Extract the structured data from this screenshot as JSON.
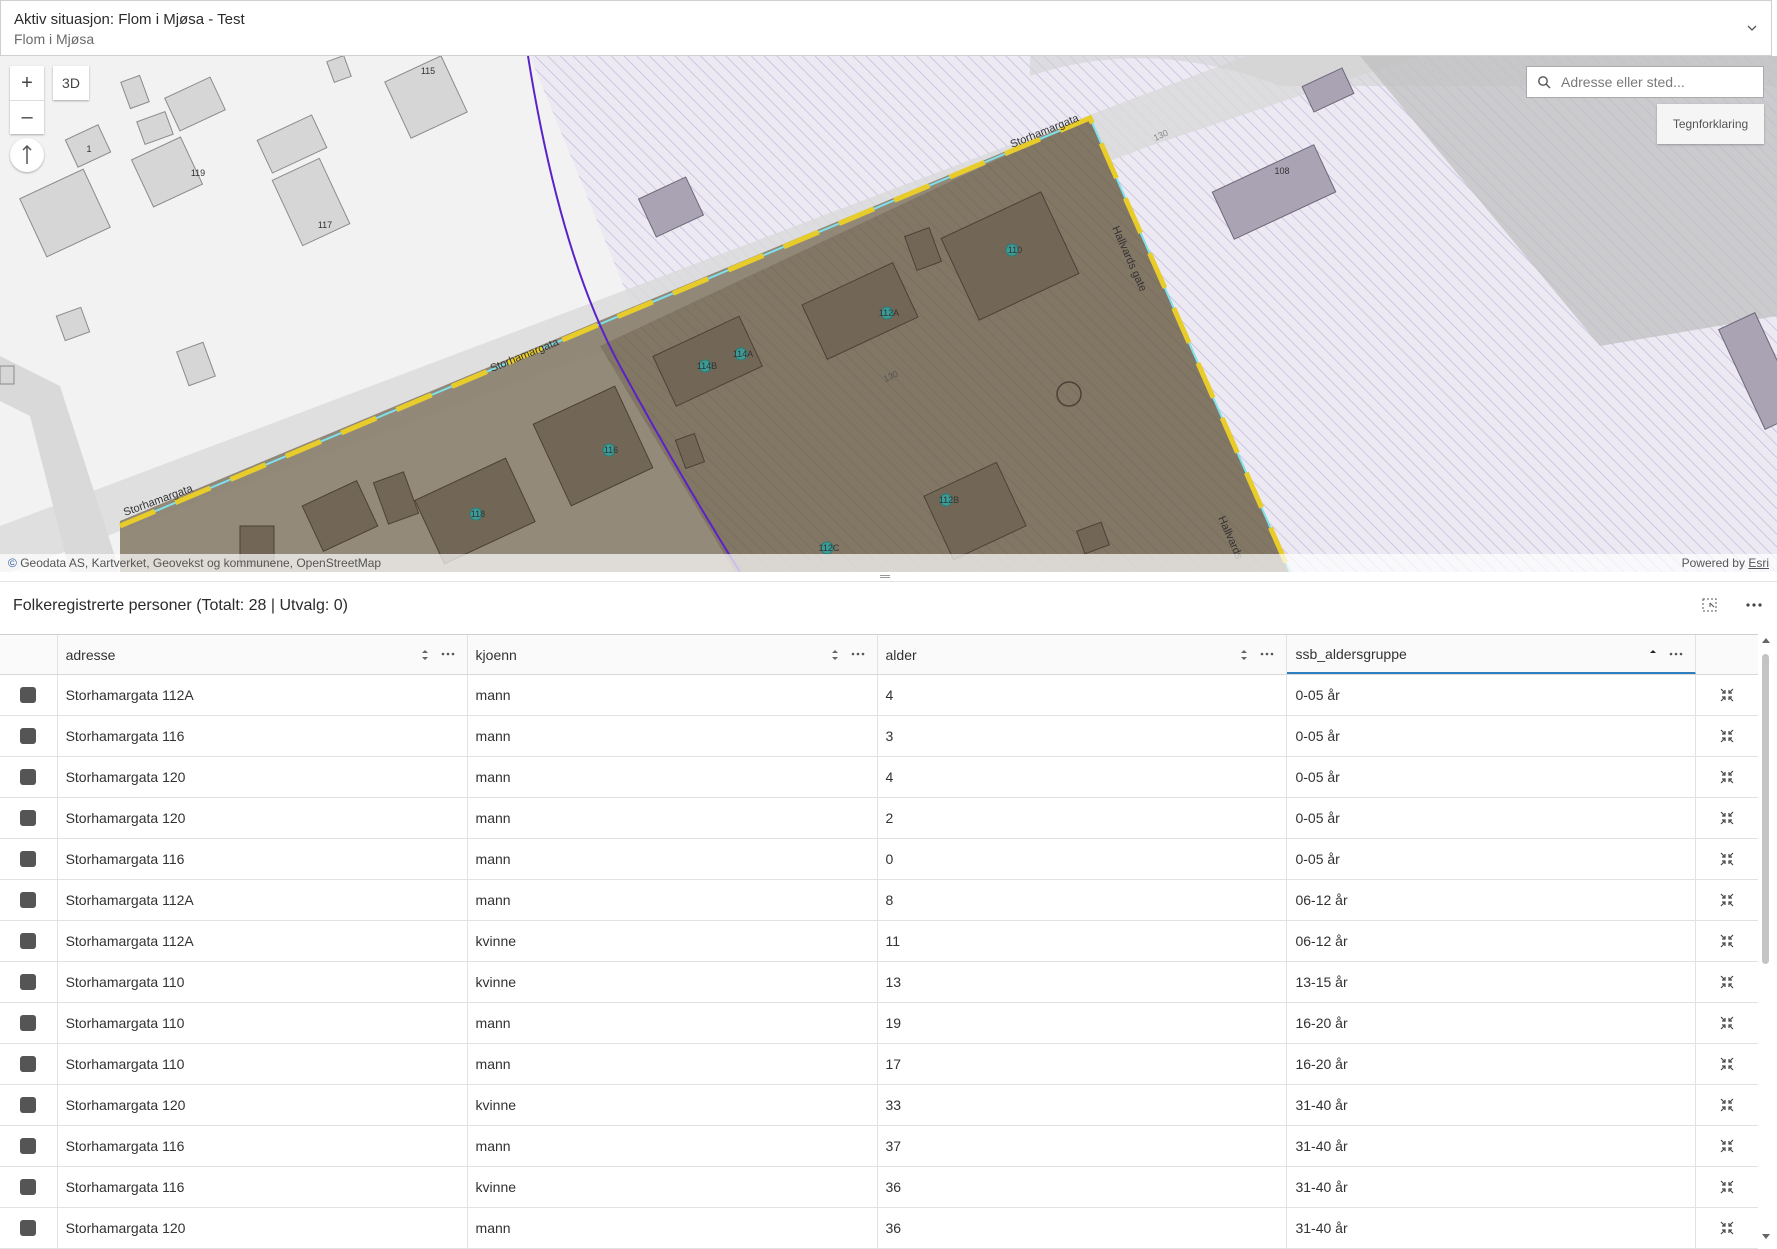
{
  "header": {
    "title": "Aktiv situasjon: Flom i Mjøsa - Test",
    "subtitle": "Flom i Mjøsa"
  },
  "map": {
    "zoom_in": "+",
    "zoom_out": "–",
    "view3d": "3D",
    "search_placeholder": "Adresse eller sted...",
    "legend_button": "Tegnforklaring",
    "attribution": "Geodata AS, Kartverket, Geovekst og kommunene, OpenStreetMap",
    "powered_by": "Powered by",
    "esri": "Esri",
    "labels": {
      "street1": "Storhamargata",
      "street2": "Storhamargata",
      "street3": "Storhamargata",
      "street4": "Hallvards gate",
      "street5": "Hallvards",
      "b115": "115",
      "b1": "1",
      "b119": "119",
      "b117": "117",
      "b108": "108",
      "b110": "110",
      "b112a": "112A",
      "b114a": "114A",
      "b114b": "114B",
      "b116": "116",
      "b118": "118",
      "b112b": "112B",
      "b112c": "112C",
      "c130a": "130",
      "c130b": "130"
    },
    "colors": {
      "flood_area": "#7a6e5e",
      "dash_yellow": "#e8cc2a",
      "outline_cyan": "#7fe0ea",
      "purple_line": "#5b22c8",
      "hatch": "#b9b2d6"
    }
  },
  "table": {
    "title": "Folkeregistrerte personer (Totalt: 28 | Utvalg: 0)",
    "columns": [
      "adresse",
      "kjoenn",
      "alder",
      "ssb_aldersgruppe"
    ],
    "rows": [
      [
        "Storhamargata 112A",
        "mann",
        "4",
        "0-05 år"
      ],
      [
        "Storhamargata 116",
        "mann",
        "3",
        "0-05 år"
      ],
      [
        "Storhamargata 120",
        "mann",
        "4",
        "0-05 år"
      ],
      [
        "Storhamargata 120",
        "mann",
        "2",
        "0-05 år"
      ],
      [
        "Storhamargata 116",
        "mann",
        "0",
        "0-05 år"
      ],
      [
        "Storhamargata 112A",
        "mann",
        "8",
        "06-12 år"
      ],
      [
        "Storhamargata 112A",
        "kvinne",
        "11",
        "06-12 år"
      ],
      [
        "Storhamargata 110",
        "kvinne",
        "13",
        "13-15 år"
      ],
      [
        "Storhamargata 110",
        "mann",
        "19",
        "16-20 år"
      ],
      [
        "Storhamargata 110",
        "mann",
        "17",
        "16-20 år"
      ],
      [
        "Storhamargata 120",
        "kvinne",
        "33",
        "31-40 år"
      ],
      [
        "Storhamargata 116",
        "mann",
        "37",
        "31-40 år"
      ],
      [
        "Storhamargata 116",
        "kvinne",
        "36",
        "31-40 år"
      ],
      [
        "Storhamargata 120",
        "mann",
        "36",
        "31-40 år"
      ]
    ]
  }
}
